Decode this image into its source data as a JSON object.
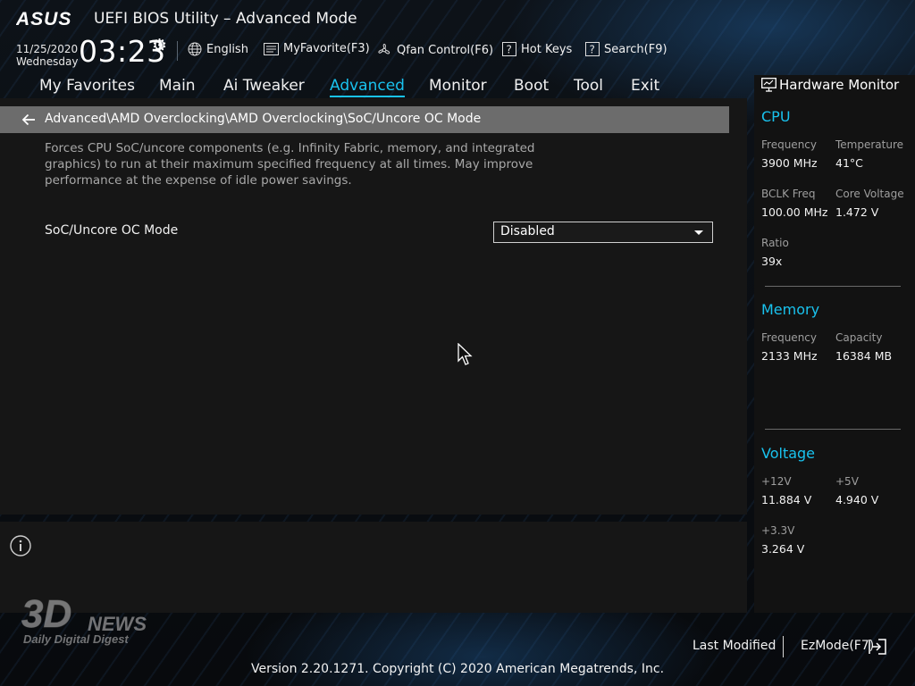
{
  "header": {
    "brand": "ASUS",
    "title": "UEFI BIOS Utility – Advanced Mode",
    "date": "11/25/2020",
    "weekday": "Wednesday",
    "time": "03:23",
    "language": "English",
    "myfavorite": "MyFavorite(F3)",
    "qfan": "Qfan Control(F6)",
    "hotkeys": "Hot Keys",
    "search": "Search(F9)"
  },
  "menu": {
    "items": [
      "My Favorites",
      "Main",
      "Ai Tweaker",
      "Advanced",
      "Monitor",
      "Boot",
      "Tool",
      "Exit"
    ],
    "active": "Advanced"
  },
  "breadcrumb": "Advanced\\AMD Overclocking\\AMD Overclocking\\SoC/Uncore OC Mode",
  "description": "Forces CPU SoC/uncore components (e.g. Infinity Fabric, memory, and integrated graphics) to run at their maximum specified frequency at all times. May improve performance at the expense of idle power savings.",
  "option": {
    "label": "SoC/Uncore OC Mode",
    "value": "Disabled"
  },
  "hardware_monitor": {
    "title": "Hardware Monitor",
    "cpu": {
      "heading": "CPU",
      "frequency_label": "Frequency",
      "frequency": "3900 MHz",
      "temperature_label": "Temperature",
      "temperature": "41°C",
      "bclk_label": "BCLK Freq",
      "bclk": "100.00 MHz",
      "core_voltage_label": "Core Voltage",
      "core_voltage": "1.472 V",
      "ratio_label": "Ratio",
      "ratio": "39x"
    },
    "memory": {
      "heading": "Memory",
      "frequency_label": "Frequency",
      "frequency": "2133 MHz",
      "capacity_label": "Capacity",
      "capacity": "16384 MB"
    },
    "voltage": {
      "heading": "Voltage",
      "v12_label": "+12V",
      "v12": "11.884 V",
      "v5_label": "+5V",
      "v5": "4.940 V",
      "v33_label": "+3.3V",
      "v33": "3.264 V"
    }
  },
  "watermark": {
    "logo": "3DNEWS",
    "tagline": "Daily Digital Digest"
  },
  "footer": {
    "last_modified": "Last Modified",
    "ezmode": "EzMode(F7)",
    "version": "Version 2.20.1271. Copyright (C) 2020 American Megatrends, Inc."
  },
  "colors": {
    "accent": "#19c2ee",
    "breadcrumb_bg": "#6c6c6c",
    "panel_bg": "#161616"
  }
}
